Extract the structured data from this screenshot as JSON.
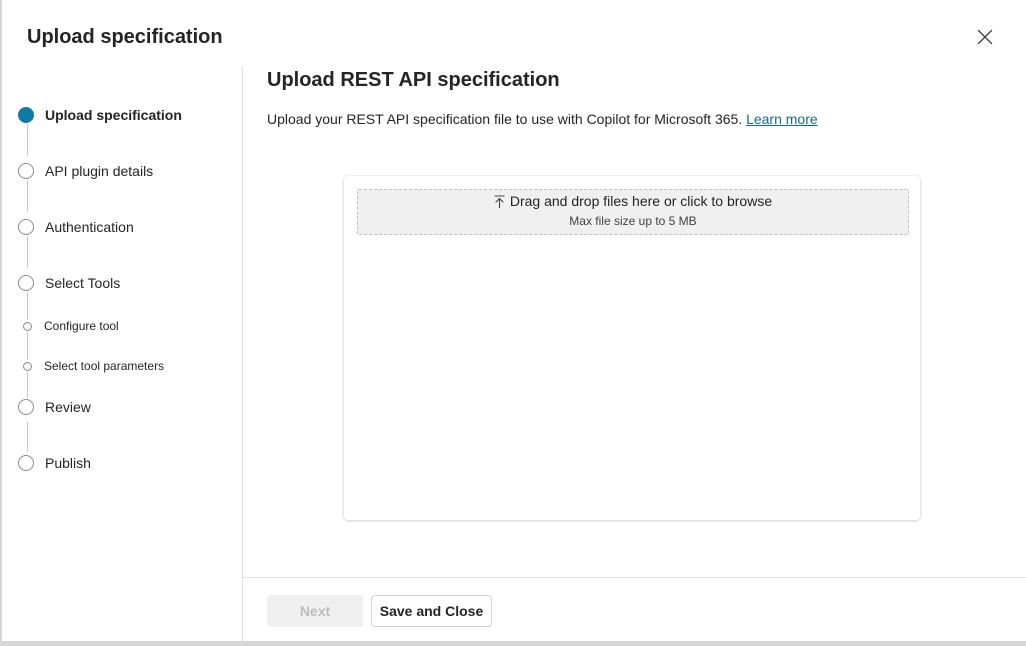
{
  "dialog": {
    "title": "Upload specification",
    "close_icon": "close-icon"
  },
  "steps": [
    {
      "label": "Upload specification",
      "state": "active"
    },
    {
      "label": "API plugin details",
      "state": "pending"
    },
    {
      "label": "Authentication",
      "state": "pending"
    },
    {
      "label": "Select Tools",
      "state": "pending"
    },
    {
      "label": "Configure tool",
      "state": "pending",
      "level": "sub"
    },
    {
      "label": "Select tool parameters",
      "state": "pending",
      "level": "sub"
    },
    {
      "label": "Review",
      "state": "pending"
    },
    {
      "label": "Publish",
      "state": "pending"
    }
  ],
  "main": {
    "title": "Upload REST API specification",
    "description": "Upload your REST API specification file to use with Copilot for Microsoft 365.",
    "learn_more": "Learn more",
    "dropzone": {
      "icon": "upload-icon",
      "label": "Drag and drop files here or click to browse",
      "hint": "Max file size up to 5 MB"
    }
  },
  "footer": {
    "next_label": "Next",
    "next_disabled": true,
    "save_label": "Save and Close"
  },
  "colors": {
    "accent": "#0e7aa8",
    "link": "#0f6f8f",
    "disabled_text": "#bdbdbd"
  }
}
